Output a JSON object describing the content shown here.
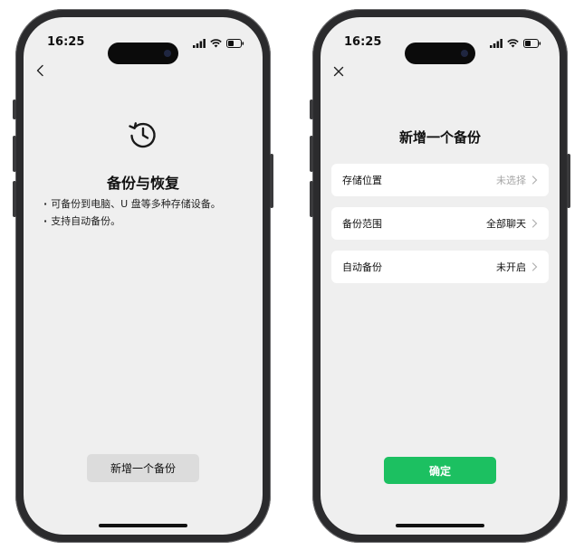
{
  "status_bar": {
    "time": "16:25"
  },
  "left_screen": {
    "title": "备份与恢复",
    "bullets": [
      "可备份到电脑、U 盘等多种存储设备。",
      "支持自动备份。"
    ],
    "new_backup_button": "新增一个备份"
  },
  "right_screen": {
    "title": "新增一个备份",
    "rows": [
      {
        "label": "存储位置",
        "value": "未选择",
        "muted": true
      },
      {
        "label": "备份范围",
        "value": "全部聊天",
        "muted": false
      },
      {
        "label": "自动备份",
        "value": "未开启",
        "muted": false
      }
    ],
    "confirm_button": "确定"
  },
  "colors": {
    "accent_green": "#1cc061",
    "screen_bg": "#efefef",
    "muted_text": "#a6a6a6"
  },
  "icons": [
    "back-icon",
    "close-icon",
    "restore-history-icon",
    "chevron-right-icon",
    "signal-icon",
    "wifi-icon",
    "battery-icon"
  ]
}
